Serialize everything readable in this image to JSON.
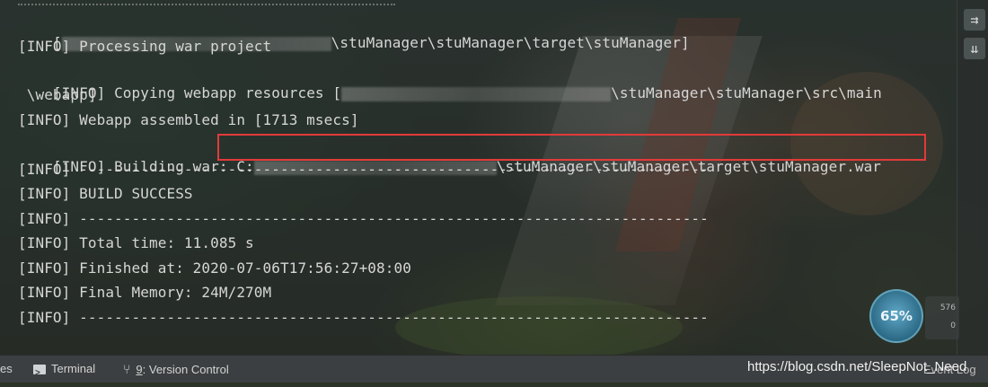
{
  "console": {
    "lines": [
      {
        "prefix": "[",
        "suffix": "\\stuManager\\stuManager\\target\\stuManager]"
      },
      {
        "text": "[INFO] Processing war project"
      },
      {
        "prefix": "[INFO] Copying webapp resources [",
        "suffix": "\\stuManager\\stuManager\\src\\main"
      },
      {
        "text": " \\webapp]"
      },
      {
        "text": "[INFO] Webapp assembled in [1713 msecs]"
      },
      {
        "prefix": "[INFO] Building war: ",
        "drive": "C:",
        "suffix": "\\stuManager\\stuManager\\target\\stuManager.war"
      },
      {
        "text": "[INFO] ------------------------------------------------------------------------"
      },
      {
        "text": "[INFO] BUILD SUCCESS"
      },
      {
        "text": "[INFO] ------------------------------------------------------------------------"
      },
      {
        "text": "[INFO] Total time: 11.085 s"
      },
      {
        "text": "[INFO] Finished at: 2020-07-06T17:56:27+08:00"
      },
      {
        "text": "[INFO] Final Memory: 24M/270M"
      },
      {
        "text": "[INFO] ------------------------------------------------------------------------"
      }
    ],
    "highlight_color": "#e23a3a"
  },
  "gutter": {
    "buttons": [
      {
        "icon": "soft-wrap-icon",
        "glyph": "⇉"
      },
      {
        "icon": "scroll-to-end-icon",
        "glyph": "⇊"
      }
    ]
  },
  "widgets": {
    "gauge_value": "65%",
    "mem_top": "576",
    "mem_bottom": "0"
  },
  "statusbar": {
    "left_cut": "es",
    "terminal": "Terminal",
    "version_control_num": "9",
    "version_control": ": Version Control",
    "event_log": "Event Log"
  },
  "watermark": "https://blog.csdn.net/SleepNot_Need"
}
